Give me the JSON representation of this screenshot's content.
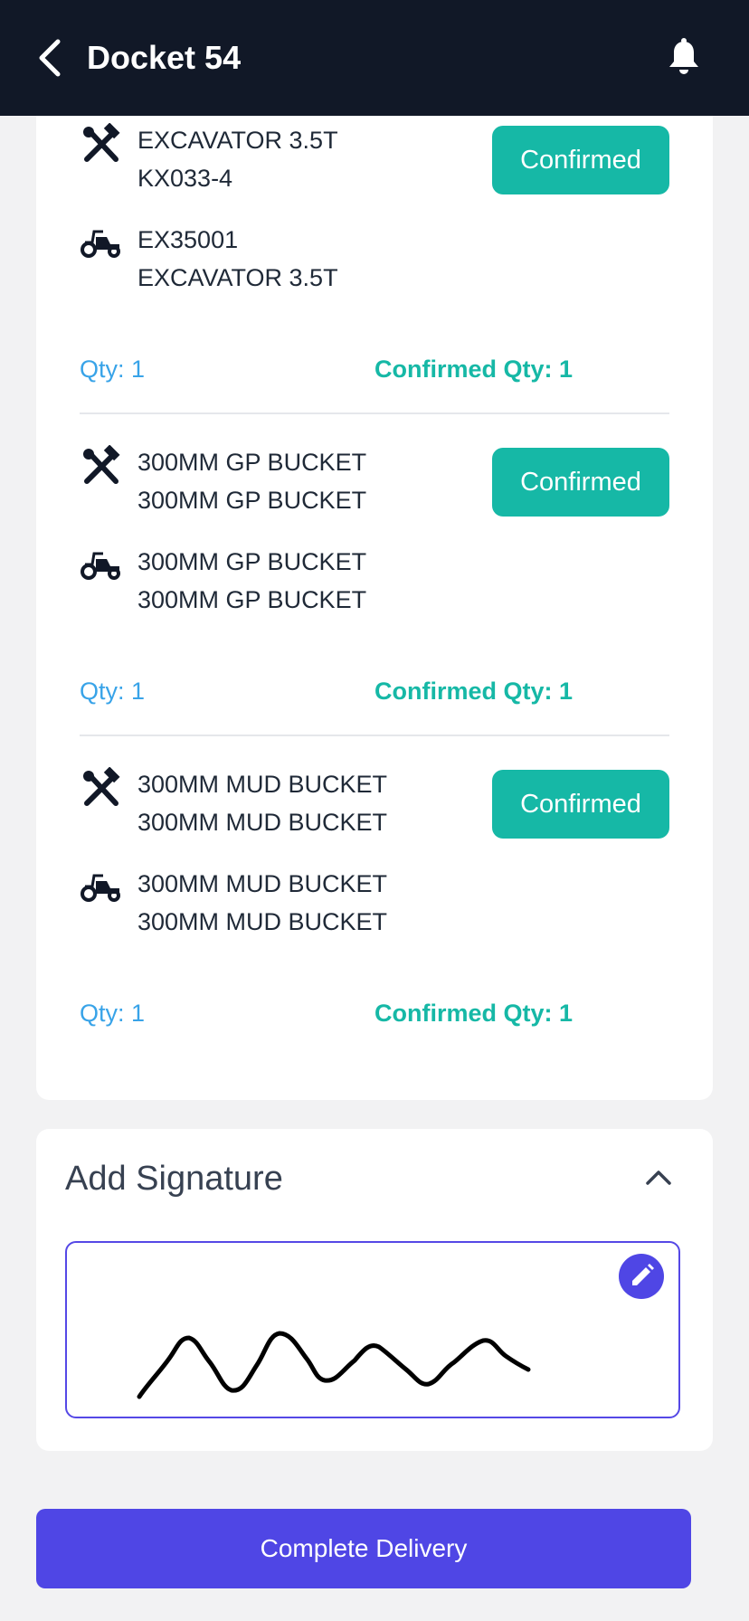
{
  "header": {
    "title": "Docket 54",
    "back_icon": "chevron-left-icon",
    "bell_icon": "bell-icon"
  },
  "items": [
    {
      "requested_line1": "EXCAVATOR 3.5T",
      "requested_line2": "KX033-4",
      "supplied_line1": "EX35001",
      "supplied_line2": "EXCAVATOR 3.5T",
      "status": "Confirmed",
      "qty": "Qty: 1",
      "confirmed_qty": "Confirmed Qty: 1"
    },
    {
      "requested_line1": "300MM GP BUCKET",
      "requested_line2": "300MM GP BUCKET",
      "supplied_line1": "300MM GP BUCKET",
      "supplied_line2": "300MM GP BUCKET",
      "status": "Confirmed",
      "qty": "Qty: 1",
      "confirmed_qty": "Confirmed Qty: 1"
    },
    {
      "requested_line1": "300MM MUD BUCKET",
      "requested_line2": "300MM MUD BUCKET",
      "supplied_line1": "300MM MUD BUCKET",
      "supplied_line2": "300MM MUD BUCKET",
      "status": "Confirmed",
      "qty": "Qty: 1",
      "confirmed_qty": "Confirmed Qty: 1"
    }
  ],
  "signature": {
    "title": "Add Signature",
    "collapse_icon": "chevron-up-icon",
    "edit_icon": "pencil-icon"
  },
  "footer": {
    "complete_label": "Complete Delivery"
  },
  "colors": {
    "header_bg": "#111827",
    "confirmed": "#16b8a6",
    "qty": "#38a3e8",
    "primary": "#4f46e5"
  }
}
